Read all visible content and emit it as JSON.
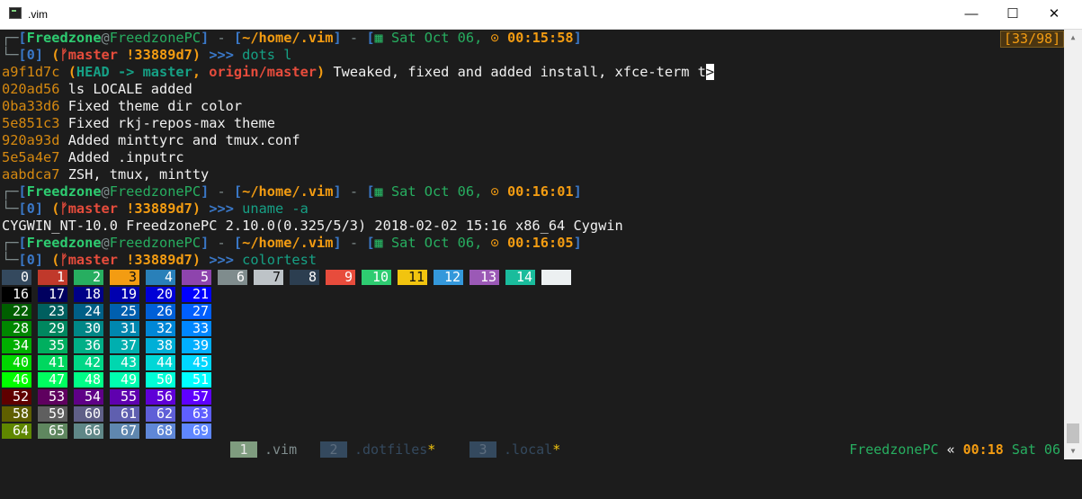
{
  "window": {
    "title": ".vim",
    "icon": "terminal-icon",
    "minimize_glyph": "—",
    "maximize_glyph": "☐",
    "close_glyph": "✕"
  },
  "position_indicator": "[33/98]",
  "prompts": [
    {
      "user": "Freedzone",
      "at": "@",
      "host": "FreedzonePC",
      "path": "~/home/.vim",
      "cal_icon": "▦",
      "date": "Sat Oct 06,",
      "clock_icon": "⊙",
      "time": "00:15:58",
      "num": "0",
      "branch_icon": "ᚠ",
      "branch": "master",
      "dirty": "!",
      "commit": "33889d7",
      "command": "dots l"
    },
    {
      "user": "Freedzone",
      "at": "@",
      "host": "FreedzonePC",
      "path": "~/home/.vim",
      "cal_icon": "▦",
      "date": "Sat Oct 06,",
      "clock_icon": "⊙",
      "time": "00:16:01",
      "num": "0",
      "branch_icon": "ᚠ",
      "branch": "master",
      "dirty": "!",
      "commit": "33889d7",
      "command": "uname -a"
    },
    {
      "user": "Freedzone",
      "at": "@",
      "host": "FreedzonePC",
      "path": "~/home/.vim",
      "cal_icon": "▦",
      "date": "Sat Oct 06,",
      "clock_icon": "⊙",
      "time": "00:16:05",
      "num": "0",
      "branch_icon": "ᚠ",
      "branch": "master",
      "dirty": "!",
      "commit": "33889d7",
      "command": "colortest"
    }
  ],
  "log": {
    "first": {
      "hash": "a9f1d7c",
      "head": "HEAD -> master",
      "origin": "origin/master",
      "message": "Tweaked, fixed and added install, xfce-term t",
      "more": ">"
    },
    "commits": [
      {
        "hash": "020ad56",
        "message": "ls LOCALE added"
      },
      {
        "hash": "0ba33d6",
        "message": "Fixed theme dir color"
      },
      {
        "hash": "5e851c3",
        "message": "Fixed rkj-repos-max theme"
      },
      {
        "hash": "920a93d",
        "message": "Added minttyrc and tmux.conf"
      },
      {
        "hash": "5e5a4e7",
        "message": "Added .inputrc"
      },
      {
        "hash": "aabdca7",
        "message": "ZSH, tmux, mintty"
      }
    ]
  },
  "uname_output": "CYGWIN_NT-10.0 FreedzonePC 2.10.0(0.325/5/3) 2018-02-02 15:16 x86_64 Cygwin",
  "colortest": {
    "basic": [
      {
        "n": "0",
        "bg": "#34495e"
      },
      {
        "n": "1",
        "bg": "#c0392b"
      },
      {
        "n": "2",
        "bg": "#27ae60"
      },
      {
        "n": "3",
        "bg": "#f39c12"
      },
      {
        "n": "4",
        "bg": "#2980b9"
      },
      {
        "n": "5",
        "bg": "#8e44ad"
      },
      {
        "n": "6",
        "bg": "#7f8c8d"
      },
      {
        "n": "7",
        "bg": "#bdc3c7"
      },
      {
        "n": "8",
        "bg": "#2c3e50"
      },
      {
        "n": "9",
        "bg": "#e74c3c"
      },
      {
        "n": "10",
        "bg": "#2ecc71"
      },
      {
        "n": "11",
        "bg": "#f1c40f"
      },
      {
        "n": "12",
        "bg": "#3498db"
      },
      {
        "n": "13",
        "bg": "#9b59b6"
      },
      {
        "n": "14",
        "bg": "#1abc9c"
      },
      {
        "n": "",
        "bg": "#ecf0f1"
      }
    ],
    "cube_rows": [
      [
        "16",
        "17",
        "18",
        "19",
        "20",
        "21"
      ],
      [
        "22",
        "23",
        "24",
        "25",
        "26",
        "27"
      ],
      [
        "28",
        "29",
        "30",
        "31",
        "32",
        "33"
      ],
      [
        "34",
        "35",
        "36",
        "37",
        "38",
        "39"
      ],
      [
        "40",
        "41",
        "42",
        "43",
        "44",
        "45"
      ],
      [
        "46",
        "47",
        "48",
        "49",
        "50",
        "51"
      ],
      [
        "52",
        "53",
        "54",
        "55",
        "56",
        "57"
      ],
      [
        "58",
        "59",
        "60",
        "61",
        "62",
        "63"
      ],
      [
        "64",
        "65",
        "66",
        "67",
        "68",
        "69"
      ]
    ]
  },
  "tmux": {
    "windows": [
      {
        "num": "1",
        "name": ".vim",
        "flag": "",
        "active": true
      },
      {
        "num": "2",
        "name": ".dotfiles",
        "flag": "*",
        "active": false
      },
      {
        "num": "3",
        "name": ".local",
        "flag": "*",
        "active": false
      }
    ],
    "host": "FreedzonePC",
    "sep": "«",
    "time": "00:18",
    "date": "Sat 06"
  },
  "colors": {
    "terminal_bg": "#1c1c1c",
    "accent_yellow": "#f39c12",
    "accent_green": "#2ecc71",
    "accent_cyan": "#16a085",
    "accent_red": "#e74c3c",
    "bracket_blue": "#3a78c8"
  }
}
